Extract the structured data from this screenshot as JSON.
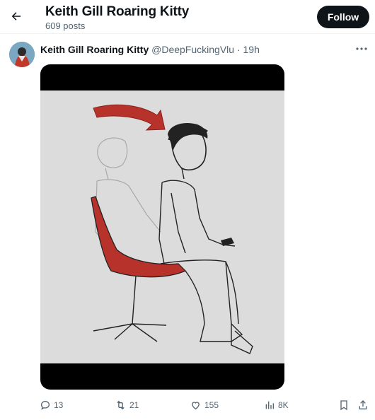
{
  "header": {
    "title": "Keith Gill Roaring Kitty",
    "posts_count": "609 posts",
    "follow_label": "Follow"
  },
  "post": {
    "author_name": "Keith Gill Roaring Kitty",
    "handle": "@DeepFuckingVlu",
    "separator": "·",
    "time": "19h",
    "media_description_icon": "sketch-image"
  },
  "actions": {
    "replies": "13",
    "reposts": "21",
    "likes": "155",
    "views": "8K"
  },
  "colors": {
    "text_primary": "#0f1419",
    "text_secondary": "#536471",
    "follow_bg": "#0f1419",
    "chair_red": "#b8322c"
  }
}
